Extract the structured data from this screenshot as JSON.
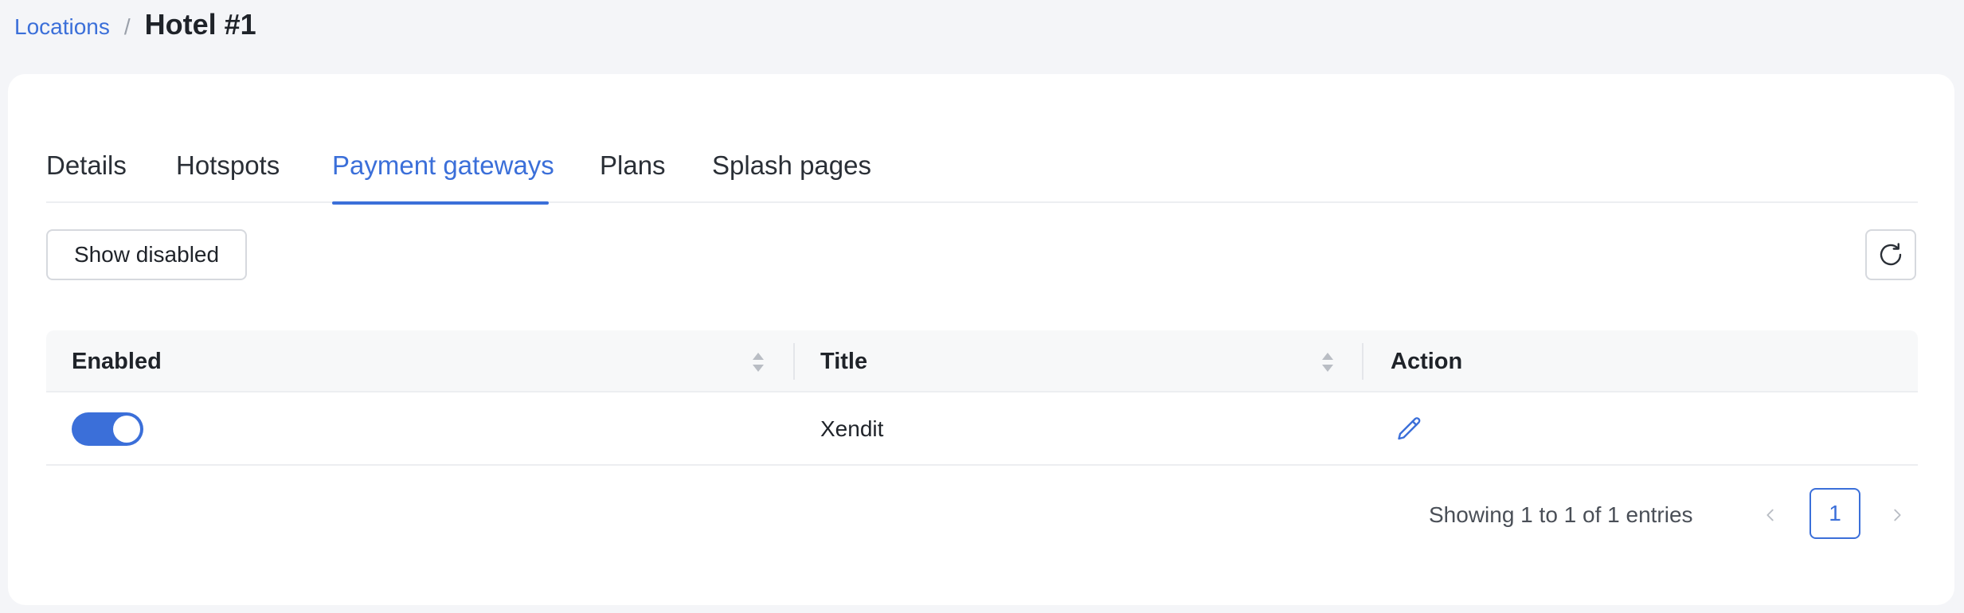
{
  "breadcrumb": {
    "parent": "Locations",
    "separator": "/",
    "current": "Hotel #1"
  },
  "tabs": [
    {
      "label": "Details",
      "active": false
    },
    {
      "label": "Hotspots",
      "active": false
    },
    {
      "label": "Payment gateways",
      "active": true
    },
    {
      "label": "Plans",
      "active": false
    },
    {
      "label": "Splash pages",
      "active": false
    }
  ],
  "toolbar": {
    "show_disabled_label": "Show disabled",
    "refresh_icon": "refresh-icon"
  },
  "table": {
    "columns": [
      {
        "label": "Enabled",
        "sortable": true
      },
      {
        "label": "Title",
        "sortable": true
      },
      {
        "label": "Action",
        "sortable": false
      }
    ],
    "rows": [
      {
        "enabled": true,
        "title": "Xendit",
        "action_icon": "pencil-icon"
      }
    ]
  },
  "pagination": {
    "summary": "Showing 1 to 1 of 1 entries",
    "current_page": "1"
  },
  "colors": {
    "accent": "#3b6fd9",
    "background": "#f4f5f8",
    "card": "#ffffff"
  }
}
